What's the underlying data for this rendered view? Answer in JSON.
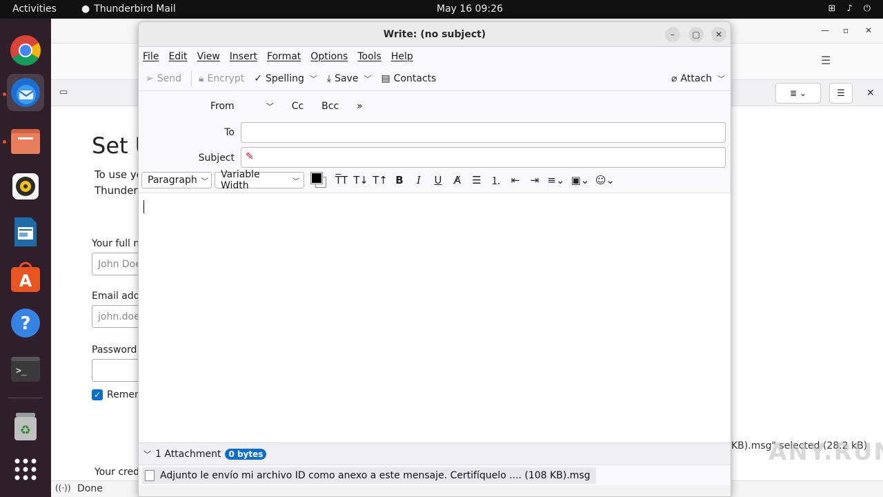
{
  "topbar": {
    "activities": "Activities",
    "app_name": "Thunderbird Mail",
    "clock": "May 16  09:26"
  },
  "dock": {
    "items": [
      "Google Chrome",
      "Thunderbird Mail",
      "Files",
      "Rhythmbox",
      "LibreOffice Writer",
      "Ubuntu Software",
      "Help",
      "Terminal",
      "Trash",
      "Show Applications"
    ]
  },
  "background_window": {
    "setup_title": "Set U",
    "setup_desc_line1": "To use yo",
    "setup_desc_line2": "Thunder",
    "full_name_label": "Your full n",
    "full_name_placeholder": "John Doe",
    "email_label": "Email addr",
    "email_placeholder": "john.doe",
    "password_label": "Password",
    "remember_label": "Remem",
    "credentials_text": "Your cred",
    "status_text": "Done",
    "selected_status": "KB).msg\" selected (28.2 kB)",
    "watermark": "ANY.RUN"
  },
  "compose": {
    "title": "Write: (no subject)",
    "menu": [
      "File",
      "Edit",
      "View",
      "Insert",
      "Format",
      "Options",
      "Tools",
      "Help"
    ],
    "toolbar": {
      "send": "Send",
      "encrypt": "Encrypt",
      "spelling": "Spelling",
      "save": "Save",
      "contacts": "Contacts",
      "attach": "Attach"
    },
    "header": {
      "from_label": "From",
      "cc": "Cc",
      "bcc": "Bcc",
      "to_label": "To",
      "subject_label": "Subject",
      "to_value": "",
      "subject_value": ""
    },
    "format": {
      "paragraph": "Paragraph",
      "font": "Variable Width",
      "text_color": "#000000",
      "bg_color": "#ffffff"
    },
    "attachments": {
      "summary": "1 Attachment",
      "size_badge": "0 bytes",
      "items": [
        "Adjunto le envío mi archivo ID como anexo a este mensaje. Certifíquelo .... (108 KB).msg"
      ]
    }
  },
  "colors": {
    "accent": "#0a6ecf",
    "ubuntu_orange": "#e95420",
    "dock_bg": "#2e1f2b"
  }
}
